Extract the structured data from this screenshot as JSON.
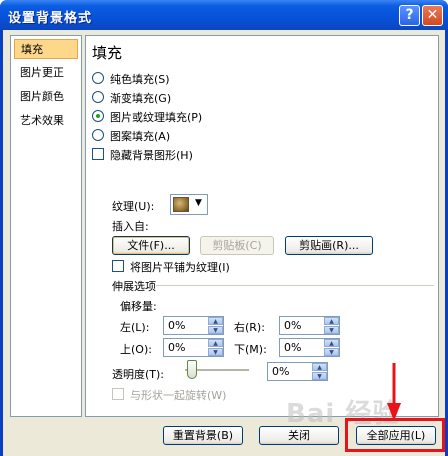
{
  "window": {
    "title": "设置背景格式",
    "help_glyph": "?",
    "close_glyph": "✕"
  },
  "nav": {
    "items": [
      {
        "label": "填充",
        "selected": true
      },
      {
        "label": "图片更正",
        "selected": false
      },
      {
        "label": "图片颜色",
        "selected": false
      },
      {
        "label": "艺术效果",
        "selected": false
      }
    ]
  },
  "fill": {
    "heading": "填充",
    "options": [
      {
        "label": "纯色填充(S)",
        "checked": false
      },
      {
        "label": "渐变填充(G)",
        "checked": false
      },
      {
        "label": "图片或纹理填充(P)",
        "checked": true
      },
      {
        "label": "图案填充(A)",
        "checked": false
      }
    ],
    "hide_bg_label": "隐藏背景图形(H)",
    "texture_label": "纹理(U):",
    "insert_from_label": "插入自:",
    "file_button": "文件(F)...",
    "clipboard_button": "剪贴板(C)",
    "clipart_button": "剪贴画(R)...",
    "tile_label": "将图片平铺为纹理(I)",
    "stretch_label": "伸展选项",
    "offset_label": "偏移量:",
    "left_label": "左(L):",
    "left_value": "0%",
    "right_label": "右(R):",
    "right_value": "0%",
    "top_label": "上(O):",
    "top_value": "0%",
    "bottom_label": "下(M):",
    "bottom_value": "0%",
    "transparency_label": "透明度(T):",
    "transparency_value": "0%",
    "rotate_label": "与形状一起旋转(W)"
  },
  "footer": {
    "reset_button": "重置背景(B)",
    "close_button": "关闭",
    "apply_all_button": "全部应用(L)"
  },
  "watermark": "Bai 经验",
  "colors": {
    "title_blue": "#0751d8",
    "annotation_red": "#e8131a",
    "selected_nav": "#fdd88b"
  }
}
